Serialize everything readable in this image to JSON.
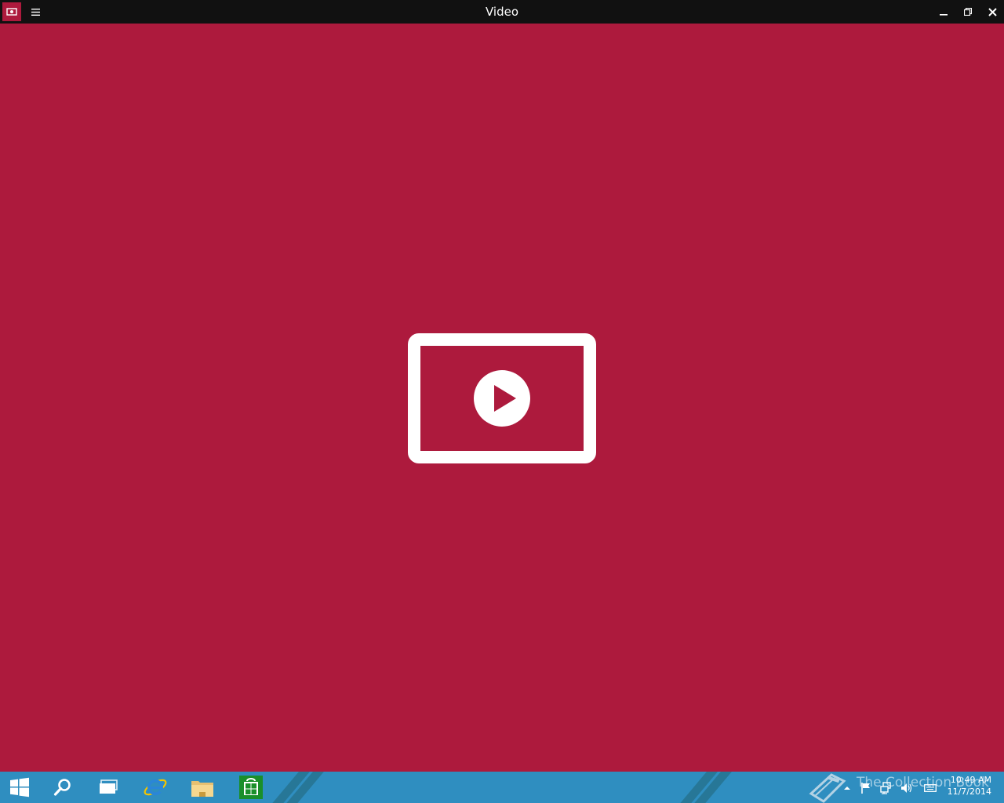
{
  "window": {
    "title": "Video",
    "accent_color": "#ad1a3d",
    "titlebar_color": "#111111",
    "app_icon": "video-app-icon",
    "menu_icon": "hamburger-menu-icon",
    "controls": [
      "minimize-icon",
      "maximize-icon",
      "close-icon"
    ]
  },
  "content": {
    "placeholder_icon": "video-play-icon"
  },
  "taskbar": {
    "color": "#2f8ec0",
    "pinned": [
      "windows-start-icon",
      "search-icon",
      "task-view-icon",
      "internet-explorer-icon",
      "file-explorer-icon",
      "store-icon"
    ],
    "watermark": "The Collection Book",
    "tray_icons": [
      "show-hidden-icons-icon",
      "action-center-flag-icon",
      "network-icon",
      "volume-icon",
      "keyboard-icon"
    ],
    "clock": {
      "time": "10:49 AM",
      "date": "11/7/2014"
    }
  }
}
